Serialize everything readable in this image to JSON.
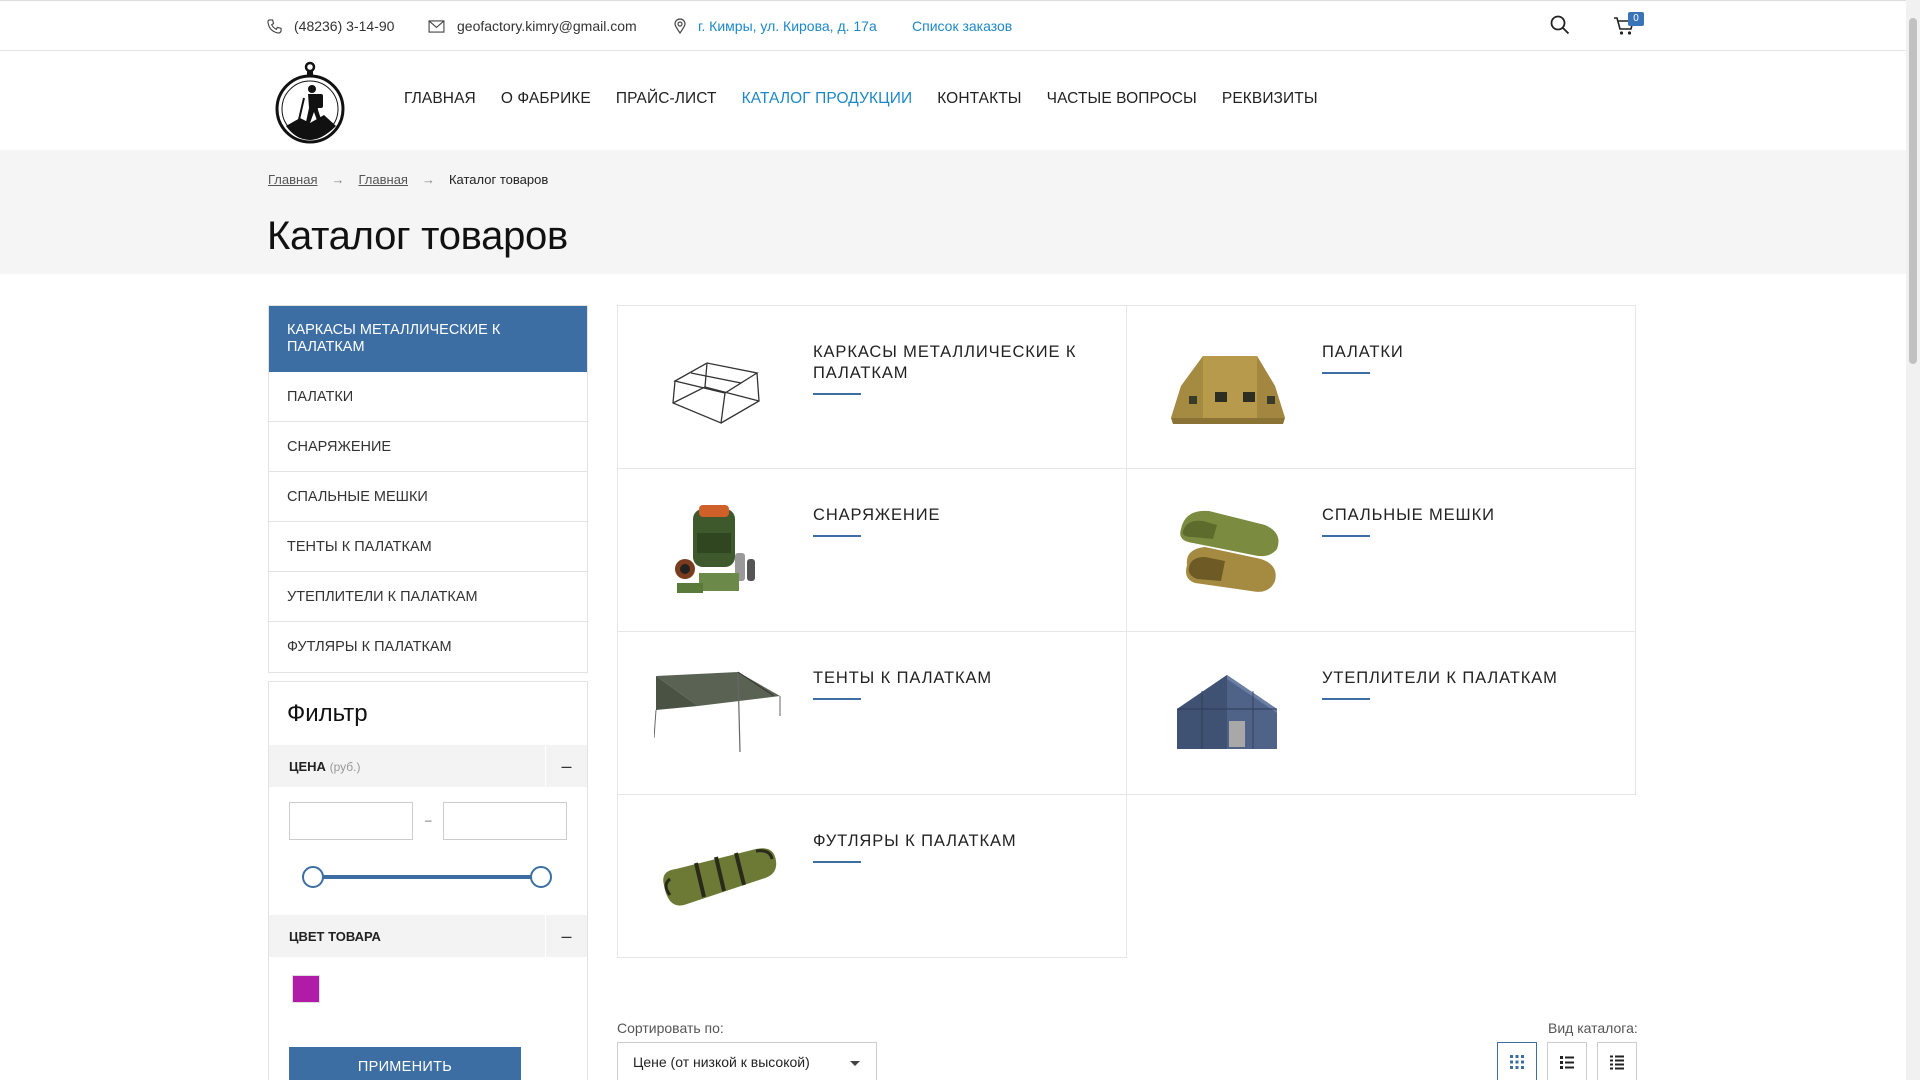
{
  "topbar": {
    "phone": "(48236) 3-14-90",
    "email": "geofactory.kimry@gmail.com",
    "address": "г. Кимры, ул. Кирова, д. 17а",
    "orders_link": "Список заказов",
    "cart_count": "0"
  },
  "nav": {
    "items": [
      "ГЛАВНАЯ",
      "О ФАБРИКЕ",
      "ПРАЙС-ЛИСТ",
      "КАТАЛОГ ПРОДУКЦИИ",
      "КОНТАКТЫ",
      "ЧАСТЫЕ ВОПРОСЫ",
      "РЕКВИЗИТЫ"
    ],
    "active": "КАТАЛОГ ПРОДУКЦИИ"
  },
  "breadcrumbs": {
    "items": [
      "Главная",
      "Главная"
    ],
    "current": "Каталог товаров"
  },
  "page_title": "Каталог товаров",
  "sidebar": {
    "items": [
      "КАРКАСЫ МЕТАЛЛИЧЕСКИЕ К ПАЛАТКАМ",
      "ПАЛАТКИ",
      "СНАРЯЖЕНИЕ",
      "СПАЛЬНЫЕ МЕШКИ",
      "ТЕНТЫ К ПАЛАТКАМ",
      "УТЕПЛИТЕЛИ К ПАЛАТКАМ",
      "ФУТЛЯРЫ К ПАЛАТКАМ"
    ]
  },
  "filter": {
    "title": "Фильтр",
    "price_label": "ЦЕНА",
    "price_unit": "(руб.)",
    "price_from": "",
    "price_to": "",
    "range_dash": "–",
    "toggle_symbol": "–",
    "color_label": "ЦВЕТ ТОВАРА",
    "color_swatch": "#b01ca8",
    "apply_label": "ПРИМЕНИТЬ"
  },
  "catalog": {
    "cards": [
      {
        "title": "КАРКАСЫ МЕТАЛЛИЧЕСКИЕ К ПАЛАТКАМ",
        "icon": "tent-frame-image"
      },
      {
        "title": "ПАЛАТКИ",
        "icon": "tent-image"
      },
      {
        "title": "СНАРЯЖЕНИЕ",
        "icon": "equipment-image"
      },
      {
        "title": "СПАЛЬНЫЕ МЕШКИ",
        "icon": "sleeping-bags-image"
      },
      {
        "title": "ТЕНТЫ К ПАЛАТКАМ",
        "icon": "tarp-image"
      },
      {
        "title": "УТЕПЛИТЕЛИ К ПАЛАТКАМ",
        "icon": "insulated-tent-image"
      },
      {
        "title": "ФУТЛЯРЫ К ПАЛАТКАМ",
        "icon": "tent-case-image"
      }
    ]
  },
  "sort": {
    "label": "Сортировать по:",
    "selected": "Цене (от низкой к высокой)"
  },
  "view": {
    "label": "Вид каталога:",
    "active": "grid"
  },
  "colors": {
    "accent": "#3d6ea3",
    "link": "#1e88c7"
  }
}
